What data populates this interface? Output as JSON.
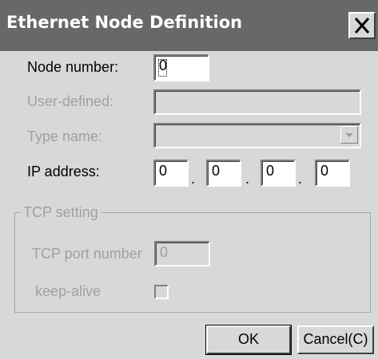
{
  "window": {
    "title": "Ethernet Node Definition"
  },
  "form": {
    "node_number": {
      "label": "Node number:",
      "value": "0"
    },
    "user_defined": {
      "label": "User-defined:",
      "value": ""
    },
    "type_name": {
      "label": "Type name:",
      "value": ""
    },
    "ip_address": {
      "label": "IP address:",
      "octets": [
        "0",
        "0",
        "0",
        "0"
      ],
      "separator": "."
    }
  },
  "tcp_setting": {
    "title": "TCP setting",
    "port": {
      "label": "TCP port number",
      "value": "0"
    },
    "keepalive": {
      "label": "keep-alive",
      "checked": false
    }
  },
  "buttons": {
    "ok": "OK",
    "cancel": "Cancel(C)"
  },
  "icons": {
    "close": "close-icon",
    "dropdown": "chevron-down-icon"
  },
  "colors": {
    "titlebar": "#686868",
    "dialog": "#d8d8d8",
    "disabled_text": "#a0a0a0"
  }
}
